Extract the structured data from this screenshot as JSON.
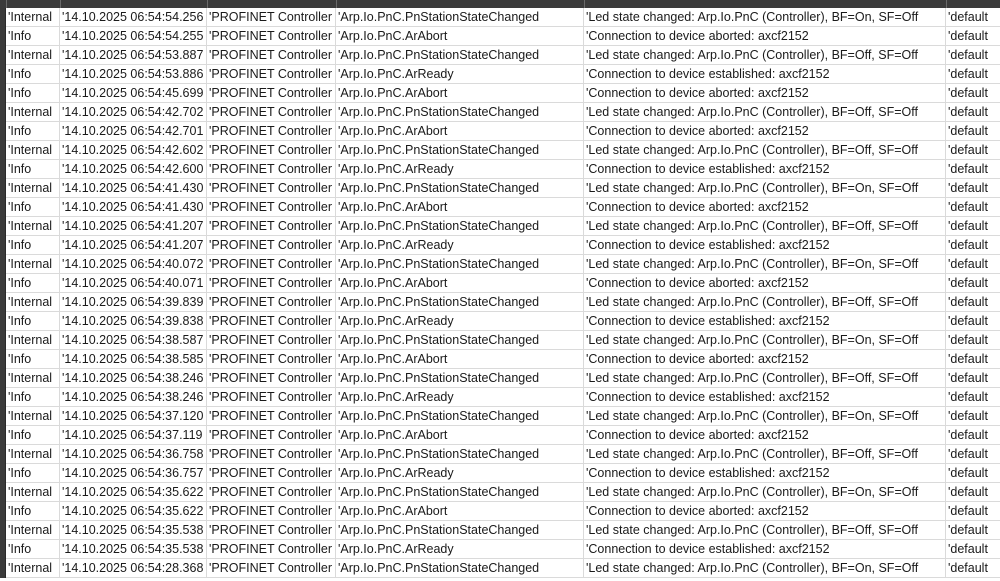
{
  "rows": [
    {
      "level": "'Internal",
      "time": "'14.10.2025 06:54:54.256",
      "component": "'PROFINET Controller",
      "event": "'Arp.Io.PnC.PnStationStateChanged",
      "message": "'Led state changed: Arp.Io.PnC (Controller), BF=On, SF=Off",
      "category": "'default"
    },
    {
      "level": "'Info",
      "time": "'14.10.2025 06:54:54.255",
      "component": "'PROFINET Controller",
      "event": "'Arp.Io.PnC.ArAbort",
      "message": "'Connection to device aborted: axcf2152",
      "category": "'default"
    },
    {
      "level": "'Internal",
      "time": "'14.10.2025 06:54:53.887",
      "component": "'PROFINET Controller",
      "event": "'Arp.Io.PnC.PnStationStateChanged",
      "message": "'Led state changed: Arp.Io.PnC (Controller), BF=Off, SF=Off",
      "category": "'default"
    },
    {
      "level": "'Info",
      "time": "'14.10.2025 06:54:53.886",
      "component": "'PROFINET Controller",
      "event": "'Arp.Io.PnC.ArReady",
      "message": "'Connection to device established: axcf2152",
      "category": "'default"
    },
    {
      "level": "'Info",
      "time": "'14.10.2025 06:54:45.699",
      "component": "'PROFINET Controller",
      "event": "'Arp.Io.PnC.ArAbort",
      "message": "'Connection to device aborted: axcf2152",
      "category": "'default"
    },
    {
      "level": "'Internal",
      "time": "'14.10.2025 06:54:42.702",
      "component": "'PROFINET Controller",
      "event": "'Arp.Io.PnC.PnStationStateChanged",
      "message": "'Led state changed: Arp.Io.PnC (Controller), BF=Off, SF=Off",
      "category": "'default"
    },
    {
      "level": "'Info",
      "time": "'14.10.2025 06:54:42.701",
      "component": "'PROFINET Controller",
      "event": "'Arp.Io.PnC.ArAbort",
      "message": "'Connection to device aborted: axcf2152",
      "category": "'default"
    },
    {
      "level": "'Internal",
      "time": "'14.10.2025 06:54:42.602",
      "component": "'PROFINET Controller",
      "event": "'Arp.Io.PnC.PnStationStateChanged",
      "message": "'Led state changed: Arp.Io.PnC (Controller), BF=Off, SF=Off",
      "category": "'default"
    },
    {
      "level": "'Info",
      "time": "'14.10.2025 06:54:42.600",
      "component": "'PROFINET Controller",
      "event": "'Arp.Io.PnC.ArReady",
      "message": "'Connection to device established: axcf2152",
      "category": "'default"
    },
    {
      "level": "'Internal",
      "time": "'14.10.2025 06:54:41.430",
      "component": "'PROFINET Controller",
      "event": "'Arp.Io.PnC.PnStationStateChanged",
      "message": "'Led state changed: Arp.Io.PnC (Controller), BF=On, SF=Off",
      "category": "'default"
    },
    {
      "level": "'Info",
      "time": "'14.10.2025 06:54:41.430",
      "component": "'PROFINET Controller",
      "event": "'Arp.Io.PnC.ArAbort",
      "message": "'Connection to device aborted: axcf2152",
      "category": "'default"
    },
    {
      "level": "'Internal",
      "time": "'14.10.2025 06:54:41.207",
      "component": "'PROFINET Controller",
      "event": "'Arp.Io.PnC.PnStationStateChanged",
      "message": "'Led state changed: Arp.Io.PnC (Controller), BF=Off, SF=Off",
      "category": "'default"
    },
    {
      "level": "'Info",
      "time": "'14.10.2025 06:54:41.207",
      "component": "'PROFINET Controller",
      "event": "'Arp.Io.PnC.ArReady",
      "message": "'Connection to device established: axcf2152",
      "category": "'default"
    },
    {
      "level": "'Internal",
      "time": "'14.10.2025 06:54:40.072",
      "component": "'PROFINET Controller",
      "event": "'Arp.Io.PnC.PnStationStateChanged",
      "message": "'Led state changed: Arp.Io.PnC (Controller), BF=On, SF=Off",
      "category": "'default"
    },
    {
      "level": "'Info",
      "time": "'14.10.2025 06:54:40.071",
      "component": "'PROFINET Controller",
      "event": "'Arp.Io.PnC.ArAbort",
      "message": "'Connection to device aborted: axcf2152",
      "category": "'default"
    },
    {
      "level": "'Internal",
      "time": "'14.10.2025 06:54:39.839",
      "component": "'PROFINET Controller",
      "event": "'Arp.Io.PnC.PnStationStateChanged",
      "message": "'Led state changed: Arp.Io.PnC (Controller), BF=Off, SF=Off",
      "category": "'default"
    },
    {
      "level": "'Info",
      "time": "'14.10.2025 06:54:39.838",
      "component": "'PROFINET Controller",
      "event": "'Arp.Io.PnC.ArReady",
      "message": "'Connection to device established: axcf2152",
      "category": "'default"
    },
    {
      "level": "'Internal",
      "time": "'14.10.2025 06:54:38.587",
      "component": "'PROFINET Controller",
      "event": "'Arp.Io.PnC.PnStationStateChanged",
      "message": "'Led state changed: Arp.Io.PnC (Controller), BF=On, SF=Off",
      "category": "'default"
    },
    {
      "level": "'Info",
      "time": "'14.10.2025 06:54:38.585",
      "component": "'PROFINET Controller",
      "event": "'Arp.Io.PnC.ArAbort",
      "message": "'Connection to device aborted: axcf2152",
      "category": "'default"
    },
    {
      "level": "'Internal",
      "time": "'14.10.2025 06:54:38.246",
      "component": "'PROFINET Controller",
      "event": "'Arp.Io.PnC.PnStationStateChanged",
      "message": "'Led state changed: Arp.Io.PnC (Controller), BF=Off, SF=Off",
      "category": "'default"
    },
    {
      "level": "'Info",
      "time": "'14.10.2025 06:54:38.246",
      "component": "'PROFINET Controller",
      "event": "'Arp.Io.PnC.ArReady",
      "message": "'Connection to device established: axcf2152",
      "category": "'default"
    },
    {
      "level": "'Internal",
      "time": "'14.10.2025 06:54:37.120",
      "component": "'PROFINET Controller",
      "event": "'Arp.Io.PnC.PnStationStateChanged",
      "message": "'Led state changed: Arp.Io.PnC (Controller), BF=On, SF=Off",
      "category": "'default"
    },
    {
      "level": "'Info",
      "time": "'14.10.2025 06:54:37.119",
      "component": "'PROFINET Controller",
      "event": "'Arp.Io.PnC.ArAbort",
      "message": "'Connection to device aborted: axcf2152",
      "category": "'default"
    },
    {
      "level": "'Internal",
      "time": "'14.10.2025 06:54:36.758",
      "component": "'PROFINET Controller",
      "event": "'Arp.Io.PnC.PnStationStateChanged",
      "message": "'Led state changed: Arp.Io.PnC (Controller), BF=Off, SF=Off",
      "category": "'default"
    },
    {
      "level": "'Info",
      "time": "'14.10.2025 06:54:36.757",
      "component": "'PROFINET Controller",
      "event": "'Arp.Io.PnC.ArReady",
      "message": "'Connection to device established: axcf2152",
      "category": "'default"
    },
    {
      "level": "'Internal",
      "time": "'14.10.2025 06:54:35.622",
      "component": "'PROFINET Controller",
      "event": "'Arp.Io.PnC.PnStationStateChanged",
      "message": "'Led state changed: Arp.Io.PnC (Controller), BF=On, SF=Off",
      "category": "'default"
    },
    {
      "level": "'Info",
      "time": "'14.10.2025 06:54:35.622",
      "component": "'PROFINET Controller",
      "event": "'Arp.Io.PnC.ArAbort",
      "message": "'Connection to device aborted: axcf2152",
      "category": "'default"
    },
    {
      "level": "'Internal",
      "time": "'14.10.2025 06:54:35.538",
      "component": "'PROFINET Controller",
      "event": "'Arp.Io.PnC.PnStationStateChanged",
      "message": "'Led state changed: Arp.Io.PnC (Controller), BF=Off, SF=Off",
      "category": "'default"
    },
    {
      "level": "'Info",
      "time": "'14.10.2025 06:54:35.538",
      "component": "'PROFINET Controller",
      "event": "'Arp.Io.PnC.ArReady",
      "message": "'Connection to device established: axcf2152",
      "category": "'default"
    },
    {
      "level": "'Internal",
      "time": "'14.10.2025 06:54:28.368",
      "component": "'PROFINET Controller",
      "event": "'Arp.Io.PnC.PnStationStateChanged",
      "message": "'Led state changed: Arp.Io.PnC (Controller), BF=On, SF=Off",
      "category": "'default"
    }
  ]
}
